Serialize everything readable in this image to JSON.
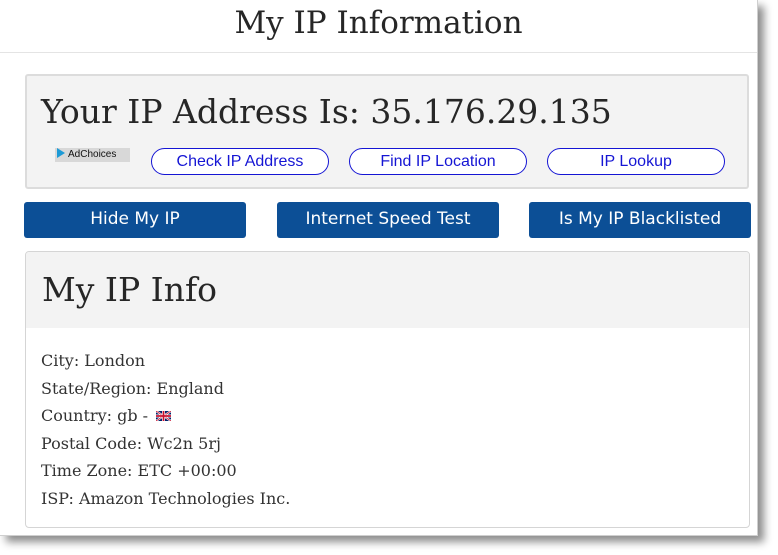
{
  "page": {
    "title": "My IP Information"
  },
  "ip_panel": {
    "heading": "Your IP Address Is: 35.176.29.135",
    "adchoices_label": "AdChoices",
    "links": [
      {
        "label": "Check IP Address"
      },
      {
        "label": "Find IP Location"
      },
      {
        "label": "IP Lookup"
      }
    ]
  },
  "nav": {
    "buttons": [
      {
        "label": "Hide My IP"
      },
      {
        "label": "Internet Speed Test"
      },
      {
        "label": "Is My IP Blacklisted"
      }
    ],
    "color": "#0c4f96"
  },
  "info": {
    "title": "My IP Info",
    "rows": [
      {
        "text": "City: London"
      },
      {
        "text": "State/Region: England"
      },
      {
        "text": "Country: gb - ",
        "icon": "uk-flag-icon"
      },
      {
        "text": "Postal Code: Wc2n 5rj"
      },
      {
        "text": "Time Zone: ETC +00:00"
      },
      {
        "text": "ISP: Amazon Technologies Inc."
      }
    ]
  },
  "colors": {
    "link": "#1515d4",
    "panel_bg": "#f3f3f3"
  }
}
